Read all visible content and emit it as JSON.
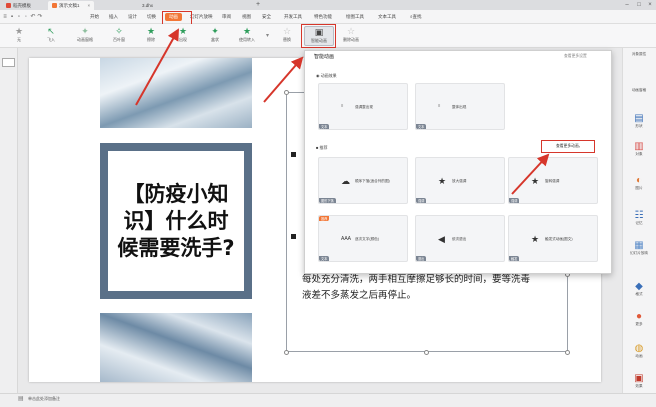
{
  "window": {
    "tabs": [
      {
        "label": "稻壳模板"
      },
      {
        "label": "演示文稿1"
      },
      {
        "label": "3.dhx"
      }
    ]
  },
  "menu": {
    "items": [
      "开始",
      "插入",
      "设计",
      "切换",
      "动画",
      "幻灯片放映",
      "审阅",
      "视图",
      "安全",
      "开发工具",
      "特色功能",
      "绘图工具",
      "文本工具",
      "查找"
    ],
    "active_index": 4
  },
  "ribbon": {
    "buttons": [
      "无",
      "飞入",
      "动画窗格",
      "百叶窗",
      "擦除",
      "出现",
      "盒状",
      "使用转入",
      "替换",
      "回顾动画",
      "智能动画",
      "删除动画"
    ]
  },
  "slide": {
    "title": "【防疫小知识】什么时候需要洗手?",
    "body_line1": "每处充分清洗，两手相互摩擦足够长的时间，要等洗毒",
    "body_line2": "液差不多蒸发之后再停止。"
  },
  "anim_popup": {
    "title": "智能动画",
    "top_link": "查看更多设置",
    "section1": "动画效果",
    "section2": "推荐",
    "more_button": "查看更多动画",
    "row1": [
      {
        "label": "强调整出现",
        "tag": "文本"
      },
      {
        "label": "整体出现",
        "tag": "文本"
      }
    ],
    "row2": [
      {
        "label": "顺序下落(适合列的图)",
        "tag": "图形下落"
      },
      {
        "label": "放大强调",
        "tag": "强调"
      },
      {
        "label": "旋转强调",
        "tag": "强调"
      }
    ],
    "row3": [
      {
        "label": "逐次文字(颜色)",
        "tag": "文本",
        "badge": "推荐"
      },
      {
        "label": "依次退出",
        "tag": "退出"
      },
      {
        "label": "触发式动画(图文)",
        "tag": "触发"
      }
    ]
  },
  "right_panel": {
    "items": [
      "对象属性",
      "动画窗格",
      "形状",
      "对象",
      "图片",
      "记忆",
      "幻灯片放映",
      "格式",
      "更多",
      "动画",
      "效果"
    ]
  },
  "status": {
    "text": "单击此处添加备注"
  },
  "colors": {
    "accent": "#f27636",
    "annotation": "#d6362b",
    "frame": "#5a7088"
  }
}
